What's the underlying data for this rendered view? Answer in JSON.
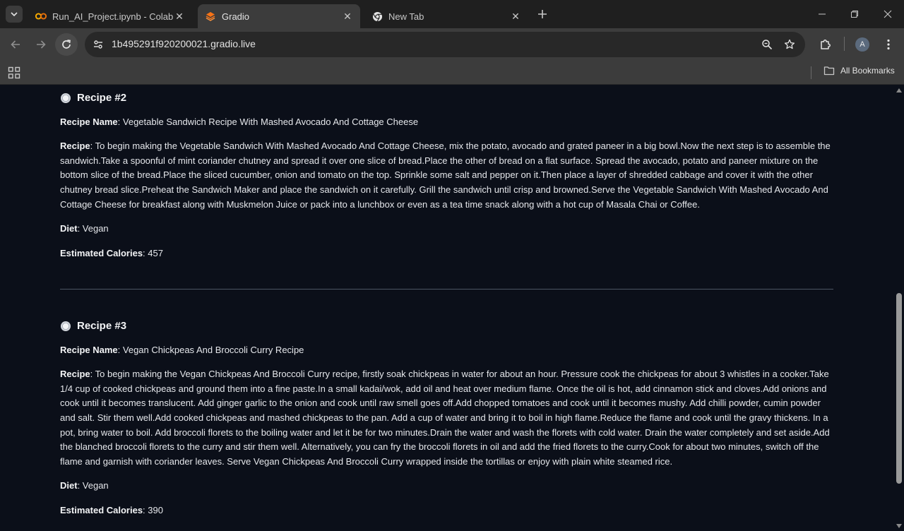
{
  "tabs": [
    {
      "label": "Run_AI_Project.ipynb - Colab",
      "icon": "colab-icon",
      "active": false
    },
    {
      "label": "Gradio",
      "icon": "gradio-icon",
      "active": true
    },
    {
      "label": "New Tab",
      "icon": "chrome-icon",
      "active": false
    }
  ],
  "toolbar": {
    "url": "1b495291f920200021.gradio.live",
    "avatar_initial": "A"
  },
  "bookmarks": {
    "all_bookmarks_label": "All Bookmarks"
  },
  "recipes": [
    {
      "heading": "Recipe #2",
      "name_label": "Recipe Name",
      "name": ": Vegetable Sandwich Recipe With Mashed Avocado And Cottage Cheese",
      "recipe_label": "Recipe",
      "recipe": ": To begin making the Vegetable Sandwich With Mashed Avocado And Cottage Cheese, mix the potato, avocado and grated paneer in a big bowl.Now the next step is to assemble the sandwich.Take a spoonful of mint coriander chutney and spread it over one slice of bread.Place the other of bread on a flat surface. Spread the avocado, potato and paneer mixture on the bottom slice of the bread.Place the sliced cucumber, onion and tomato on the top. Sprinkle some salt and pepper on it.Then place a layer of shredded cabbage and cover it with the other chutney bread slice.Preheat the Sandwich Maker and place the sandwich on it carefully. Grill the sandwich until crisp and browned.Serve the Vegetable Sandwich With Mashed Avocado And Cottage Cheese for breakfast along with Muskmelon Juice or pack into a lunchbox or even as a tea time snack along with a hot cup of Masala Chai or Coffee.",
      "diet_label": "Diet",
      "diet": ": Vegan",
      "calories_label": "Estimated Calories",
      "calories": ": 457"
    },
    {
      "heading": "Recipe #3",
      "name_label": "Recipe Name",
      "name": ": Vegan Chickpeas And Broccoli Curry Recipe",
      "recipe_label": "Recipe",
      "recipe": ": To begin making the Vegan Chickpeas And Broccoli Curry recipe, firstly soak chickpeas in water for about an hour. Pressure cook the chickpeas for about 3 whistles in a cooker.Take 1/4 cup of cooked chickpeas and ground them into a fine paste.In a small kadai/wok, add oil and heat over medium flame. Once the oil is hot, add cinnamon stick and cloves.Add onions and cook until it becomes translucent. Add ginger garlic to the onion and cook until raw smell goes off.Add chopped tomatoes and cook until it becomes mushy. Add chilli powder, cumin powder and salt. Stir them well.Add cooked chickpeas and mashed chickpeas to the pan. Add a cup of water and bring it to boil in high flame.Reduce the flame and cook until the gravy thickens. In a pot, bring water to boil. Add broccoli florets to the boiling water and let it be for two minutes.Drain the water and wash the florets with cold water. Drain the water completely and set aside.Add the blanched broccoli florets to the curry and stir them well. Alternatively, you can fry the broccoli florets in oil and add the fried florets to the curry.Cook for about two minutes, switch off the flame and garnish with coriander leaves. Serve Vegan Chickpeas And Broccoli Curry wrapped inside the tortillas or enjoy with plain white steamed rice.",
      "diet_label": "Diet",
      "diet": ": Vegan",
      "calories_label": "Estimated Calories",
      "calories": ": 390"
    }
  ]
}
